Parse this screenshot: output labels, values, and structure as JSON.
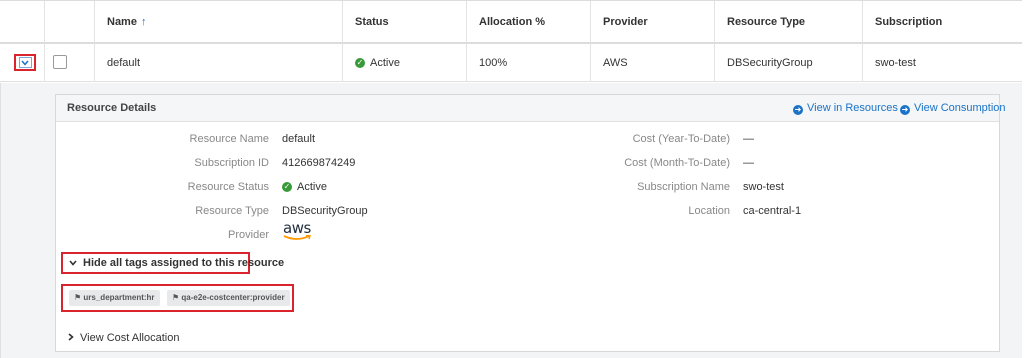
{
  "table": {
    "headers": {
      "name": "Name",
      "name_sort": "↑",
      "status": "Status",
      "allocation": "Allocation %",
      "provider": "Provider",
      "resource_type": "Resource Type",
      "subscription": "Subscription"
    },
    "row": {
      "name": "default",
      "status": "Active",
      "allocation": "100%",
      "provider": "AWS",
      "resource_type": "DBSecurityGroup",
      "subscription": "swo-test"
    }
  },
  "details": {
    "title": "Resource Details",
    "view_in_resources": "View in Resources",
    "view_consumption": "View Consumption",
    "left": {
      "resource_name_label": "Resource Name",
      "resource_name": "default",
      "subscription_id_label": "Subscription ID",
      "subscription_id": "412669874249",
      "resource_status_label": "Resource Status",
      "resource_status": "Active",
      "resource_type_label": "Resource Type",
      "resource_type": "DBSecurityGroup",
      "provider_label": "Provider",
      "provider_logo": "aws"
    },
    "right": {
      "cost_ytd_label": "Cost (Year-To-Date)",
      "cost_ytd": "—",
      "cost_mtd_label": "Cost (Month-To-Date)",
      "cost_mtd": "—",
      "subscription_name_label": "Subscription Name",
      "subscription_name": "swo-test",
      "location_label": "Location",
      "location": "ca-central-1"
    },
    "hide_tags": "Hide all tags assigned to this resource",
    "tags": [
      "urs_department:hr",
      "qa-e2e-costcenter:provider"
    ],
    "view_cost_allocation": "View Cost Allocation"
  },
  "colors": {
    "accent": "#1a73c8",
    "highlight": "#d9232d",
    "active": "#3a9a3a"
  },
  "icons": {
    "sort": "arrow-up-icon",
    "expand": "chevron-down-icon",
    "status": "check-circle-icon",
    "link": "arrow-circle-right-icon",
    "tag": "tag-icon",
    "collapse": "chevron-right-icon"
  }
}
